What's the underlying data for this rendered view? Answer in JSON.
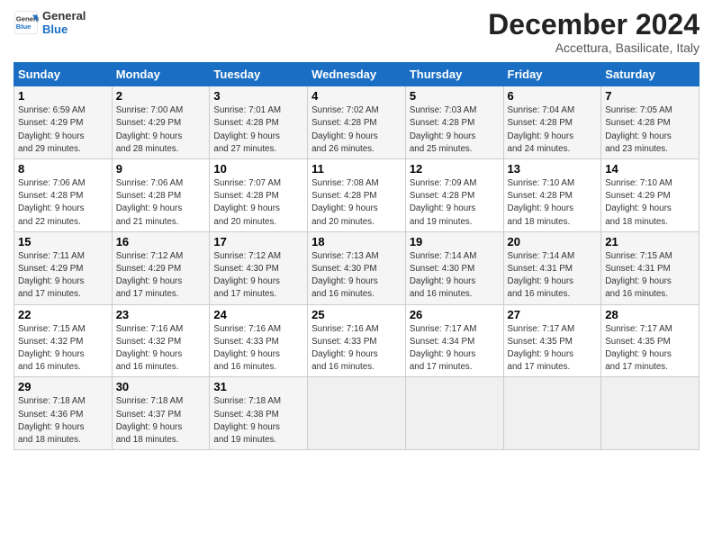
{
  "header": {
    "logo_line1": "General",
    "logo_line2": "Blue",
    "month": "December 2024",
    "location": "Accettura, Basilicate, Italy"
  },
  "weekdays": [
    "Sunday",
    "Monday",
    "Tuesday",
    "Wednesday",
    "Thursday",
    "Friday",
    "Saturday"
  ],
  "weeks": [
    [
      {
        "day": "1",
        "info": "Sunrise: 6:59 AM\nSunset: 4:29 PM\nDaylight: 9 hours\nand 29 minutes."
      },
      {
        "day": "2",
        "info": "Sunrise: 7:00 AM\nSunset: 4:29 PM\nDaylight: 9 hours\nand 28 minutes."
      },
      {
        "day": "3",
        "info": "Sunrise: 7:01 AM\nSunset: 4:28 PM\nDaylight: 9 hours\nand 27 minutes."
      },
      {
        "day": "4",
        "info": "Sunrise: 7:02 AM\nSunset: 4:28 PM\nDaylight: 9 hours\nand 26 minutes."
      },
      {
        "day": "5",
        "info": "Sunrise: 7:03 AM\nSunset: 4:28 PM\nDaylight: 9 hours\nand 25 minutes."
      },
      {
        "day": "6",
        "info": "Sunrise: 7:04 AM\nSunset: 4:28 PM\nDaylight: 9 hours\nand 24 minutes."
      },
      {
        "day": "7",
        "info": "Sunrise: 7:05 AM\nSunset: 4:28 PM\nDaylight: 9 hours\nand 23 minutes."
      }
    ],
    [
      {
        "day": "8",
        "info": "Sunrise: 7:06 AM\nSunset: 4:28 PM\nDaylight: 9 hours\nand 22 minutes."
      },
      {
        "day": "9",
        "info": "Sunrise: 7:06 AM\nSunset: 4:28 PM\nDaylight: 9 hours\nand 21 minutes."
      },
      {
        "day": "10",
        "info": "Sunrise: 7:07 AM\nSunset: 4:28 PM\nDaylight: 9 hours\nand 20 minutes."
      },
      {
        "day": "11",
        "info": "Sunrise: 7:08 AM\nSunset: 4:28 PM\nDaylight: 9 hours\nand 20 minutes."
      },
      {
        "day": "12",
        "info": "Sunrise: 7:09 AM\nSunset: 4:28 PM\nDaylight: 9 hours\nand 19 minutes."
      },
      {
        "day": "13",
        "info": "Sunrise: 7:10 AM\nSunset: 4:28 PM\nDaylight: 9 hours\nand 18 minutes."
      },
      {
        "day": "14",
        "info": "Sunrise: 7:10 AM\nSunset: 4:29 PM\nDaylight: 9 hours\nand 18 minutes."
      }
    ],
    [
      {
        "day": "15",
        "info": "Sunrise: 7:11 AM\nSunset: 4:29 PM\nDaylight: 9 hours\nand 17 minutes."
      },
      {
        "day": "16",
        "info": "Sunrise: 7:12 AM\nSunset: 4:29 PM\nDaylight: 9 hours\nand 17 minutes."
      },
      {
        "day": "17",
        "info": "Sunrise: 7:12 AM\nSunset: 4:30 PM\nDaylight: 9 hours\nand 17 minutes."
      },
      {
        "day": "18",
        "info": "Sunrise: 7:13 AM\nSunset: 4:30 PM\nDaylight: 9 hours\nand 16 minutes."
      },
      {
        "day": "19",
        "info": "Sunrise: 7:14 AM\nSunset: 4:30 PM\nDaylight: 9 hours\nand 16 minutes."
      },
      {
        "day": "20",
        "info": "Sunrise: 7:14 AM\nSunset: 4:31 PM\nDaylight: 9 hours\nand 16 minutes."
      },
      {
        "day": "21",
        "info": "Sunrise: 7:15 AM\nSunset: 4:31 PM\nDaylight: 9 hours\nand 16 minutes."
      }
    ],
    [
      {
        "day": "22",
        "info": "Sunrise: 7:15 AM\nSunset: 4:32 PM\nDaylight: 9 hours\nand 16 minutes."
      },
      {
        "day": "23",
        "info": "Sunrise: 7:16 AM\nSunset: 4:32 PM\nDaylight: 9 hours\nand 16 minutes."
      },
      {
        "day": "24",
        "info": "Sunrise: 7:16 AM\nSunset: 4:33 PM\nDaylight: 9 hours\nand 16 minutes."
      },
      {
        "day": "25",
        "info": "Sunrise: 7:16 AM\nSunset: 4:33 PM\nDaylight: 9 hours\nand 16 minutes."
      },
      {
        "day": "26",
        "info": "Sunrise: 7:17 AM\nSunset: 4:34 PM\nDaylight: 9 hours\nand 17 minutes."
      },
      {
        "day": "27",
        "info": "Sunrise: 7:17 AM\nSunset: 4:35 PM\nDaylight: 9 hours\nand 17 minutes."
      },
      {
        "day": "28",
        "info": "Sunrise: 7:17 AM\nSunset: 4:35 PM\nDaylight: 9 hours\nand 17 minutes."
      }
    ],
    [
      {
        "day": "29",
        "info": "Sunrise: 7:18 AM\nSunset: 4:36 PM\nDaylight: 9 hours\nand 18 minutes."
      },
      {
        "day": "30",
        "info": "Sunrise: 7:18 AM\nSunset: 4:37 PM\nDaylight: 9 hours\nand 18 minutes."
      },
      {
        "day": "31",
        "info": "Sunrise: 7:18 AM\nSunset: 4:38 PM\nDaylight: 9 hours\nand 19 minutes."
      },
      null,
      null,
      null,
      null
    ]
  ]
}
